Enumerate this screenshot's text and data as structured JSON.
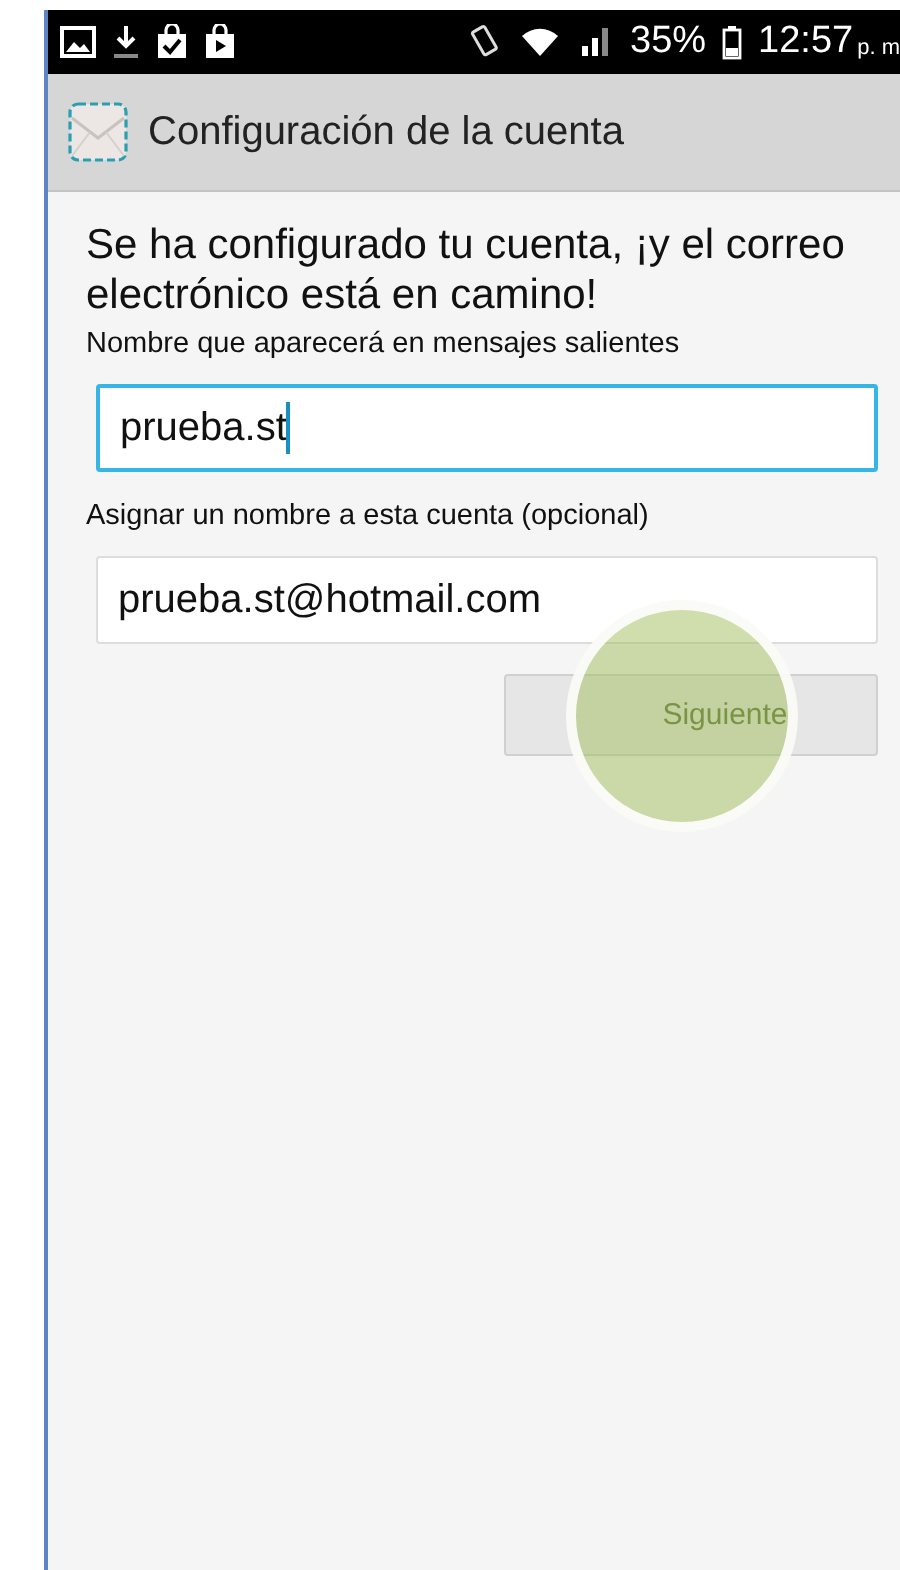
{
  "status_bar": {
    "battery": "35%",
    "time": "12:57",
    "time_suffix": "p. m"
  },
  "action_bar": {
    "title": "Configuración de la cuenta"
  },
  "message": "Se ha configurado tu cuenta, ¡y el correo electrónico está en camino!",
  "fields": [
    {
      "label": "Nombre que aparecerá en mensajes salientes",
      "value": "prueba.st",
      "focused": true
    },
    {
      "label": "Asignar un nombre a esta cuenta (opcional)",
      "value": "prueba.st@hotmail.com",
      "focused": false
    }
  ],
  "next_button": {
    "label": "Siguiente"
  }
}
